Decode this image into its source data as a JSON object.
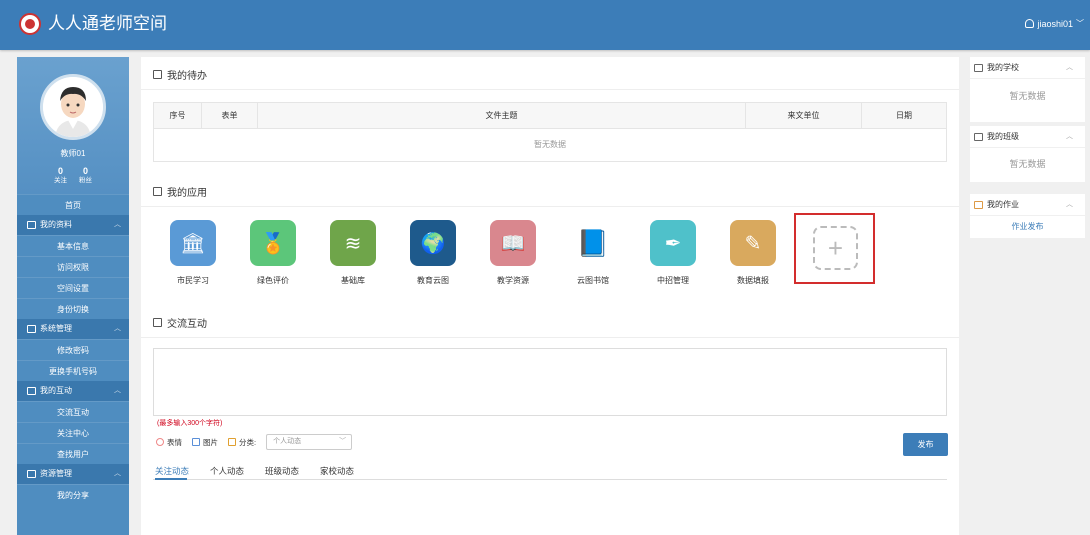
{
  "header": {
    "app_title": "人人通老师空间",
    "username": "jiaoshi01"
  },
  "sidebar": {
    "name": "教师01",
    "follow_count": "0",
    "follow_label": "关注",
    "fans_count": "0",
    "fans_label": "粉丝",
    "home": "首页",
    "groups": [
      {
        "label": "我的资料",
        "items": [
          "基本信息",
          "访问权限",
          "空间设置",
          "身份切换"
        ]
      },
      {
        "label": "系统管理",
        "items": [
          "修改密码",
          "更换手机号码"
        ]
      },
      {
        "label": "我的互动",
        "items": [
          "交流互动",
          "关注中心",
          "查找用户"
        ]
      },
      {
        "label": "资源管理",
        "items": [
          "我的分享"
        ]
      }
    ]
  },
  "todo": {
    "title": "我的待办",
    "columns": [
      "序号",
      "表单",
      "文件主题",
      "来文单位",
      "日期"
    ],
    "empty": "暂无数据"
  },
  "apps": {
    "title": "我的应用",
    "items": [
      {
        "label": "市民学习",
        "color": "#5a9ad6",
        "icon": "building-icon"
      },
      {
        "label": "绿色评价",
        "color": "#5cc67a",
        "icon": "medal-icon"
      },
      {
        "label": "基础库",
        "color": "#6fa54a",
        "icon": "database-icon"
      },
      {
        "label": "教育云图",
        "color": "#1e5a8c",
        "icon": "globe-icon"
      },
      {
        "label": "教学资源",
        "color": "#d9878e",
        "icon": "book-icon"
      },
      {
        "label": "云图书馆",
        "color": "#ffffff",
        "icon": "open-book-icon"
      },
      {
        "label": "中招管理",
        "color": "#4fc1ca",
        "icon": "pen-icon"
      },
      {
        "label": "数据填报",
        "color": "#d9a95e",
        "icon": "edit-icon"
      }
    ]
  },
  "interact": {
    "title": "交流互动",
    "limit_note": "(最多输入300个字符)",
    "emoji": "表情",
    "image": "图片",
    "category_label": "分类:",
    "category_value": "个人动态",
    "publish": "发布",
    "tabs": [
      "关注动态",
      "个人动态",
      "班级动态",
      "家校动态"
    ]
  },
  "right": {
    "school": {
      "title": "我的学校",
      "body": "暂无数据"
    },
    "class": {
      "title": "我的班级",
      "body": "暂无数据"
    },
    "homework": {
      "title": "我的作业",
      "body": "作业发布"
    }
  }
}
